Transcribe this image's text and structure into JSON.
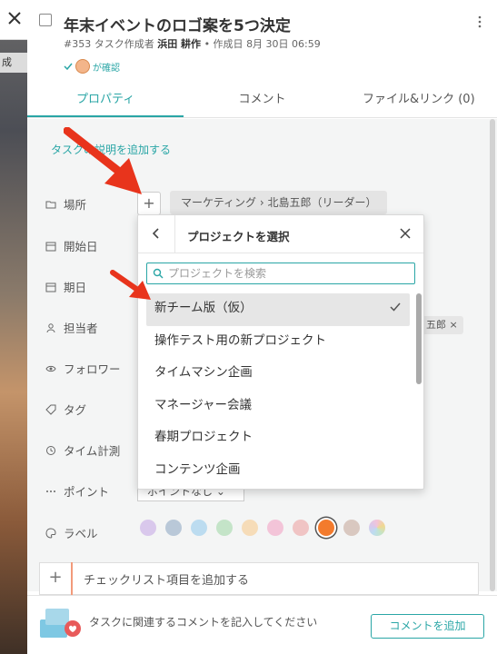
{
  "window": {
    "close_label": "×",
    "side_label": "成"
  },
  "task": {
    "title": "年末イベントのロゴ案を5つ決定",
    "id": "#353",
    "creator_prefix": "タスク作成者",
    "creator": "浜田 耕作",
    "created_prefix": "• 作成日",
    "created": "8月 30日 06:59",
    "confirmed_label": "が確認"
  },
  "tabs": [
    {
      "label": "プロパティ"
    },
    {
      "label": "コメント"
    },
    {
      "label": "ファイル&リンク (0)"
    }
  ],
  "add_description": "タスクの説明を追加する",
  "properties": {
    "place": "場所",
    "start": "開始日",
    "due": "期日",
    "assignee": "担当者",
    "follower": "フォロワー",
    "tag": "タグ",
    "time": "タイム計測",
    "point": "ポイント",
    "label": "ラベル"
  },
  "place_plus": "+",
  "project_path": "マーケティング › 北島五郎（リーダー）",
  "assignee_chip": "五郎 ×",
  "point_value": "ポイントなし ⌄",
  "label_colors": [
    "#d9c8ec",
    "#b9c8d8",
    "#bcdcf0",
    "#c4e4c8",
    "#f6dcb8",
    "#f3c4d8",
    "#f0c4c4",
    "#f37b2d",
    "#d9c8c0",
    "#f0d890"
  ],
  "checklist": {
    "plus": "+",
    "placeholder": "チェックリスト項目を追加する"
  },
  "footer": {
    "hint": "タスクに関連するコメントを記入してください",
    "button": "コメントを追加"
  },
  "popup": {
    "title": "プロジェクトを選択",
    "search_placeholder": "プロジェクトを検索",
    "items": [
      {
        "label": "新チーム版（仮）",
        "selected": true
      },
      {
        "label": "操作テスト用の新プロジェクト"
      },
      {
        "label": "タイムマシン企画"
      },
      {
        "label": "マネージャー会議"
      },
      {
        "label": "春期プロジェクト"
      },
      {
        "label": "コンテンツ企画"
      }
    ]
  }
}
